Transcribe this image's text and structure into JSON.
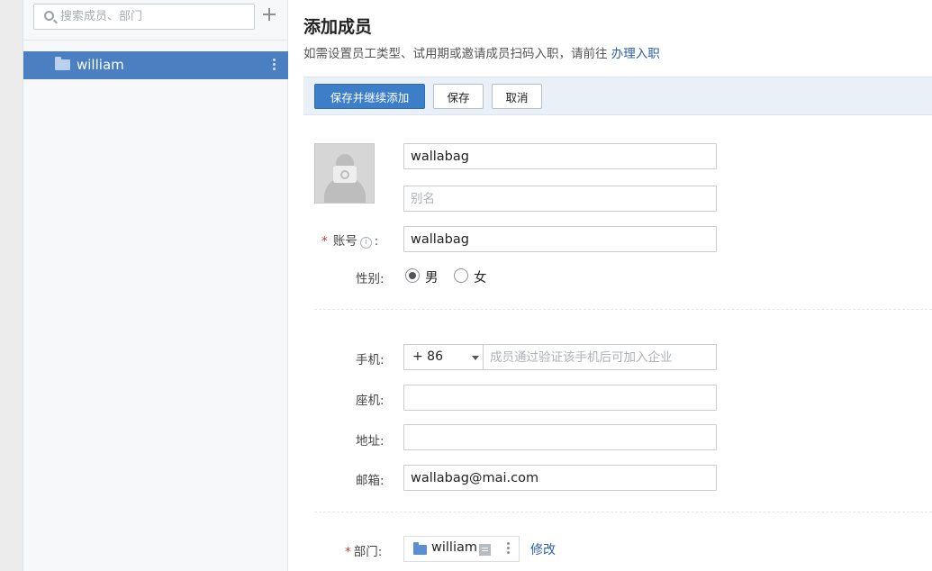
{
  "sidebar": {
    "search_placeholder": "搜索成员、部门",
    "departments": [
      {
        "label": "william"
      }
    ]
  },
  "main": {
    "title": "添加成员",
    "subtitle": "如需设置员工类型、试用期或邀请成员扫码入职，请前往",
    "subtitle_link": "办理入职"
  },
  "toolbar": {
    "save_continue_label": "保存并继续添加",
    "save_label": "保存",
    "cancel_label": "取消"
  },
  "form": {
    "name_value": "wallabag",
    "alias_placeholder": "别名",
    "account_label": "账号",
    "account_value": "wallabag",
    "gender_label": "性别:",
    "gender_male": "男",
    "gender_female": "女",
    "gender_selected": "男",
    "mobile_label": "手机:",
    "country_code": "+ 86",
    "mobile_placeholder": "成员通过验证该手机后可加入企业",
    "landline_label": "座机:",
    "landline_value": "",
    "address_label": "地址:",
    "address_value": "",
    "email_label": "邮箱:",
    "email_value": "wallabag@mai.com",
    "department_label": "部门:",
    "department_value": "william",
    "department_edit": "修改",
    "required_mark": "*",
    "colon": ":",
    "info_glyph": "i"
  },
  "colors": {
    "sidebar_selected": "#4a80c2",
    "primary_button": "#3d7ec9",
    "link": "#2a5fa6",
    "required": "#cc3333"
  }
}
